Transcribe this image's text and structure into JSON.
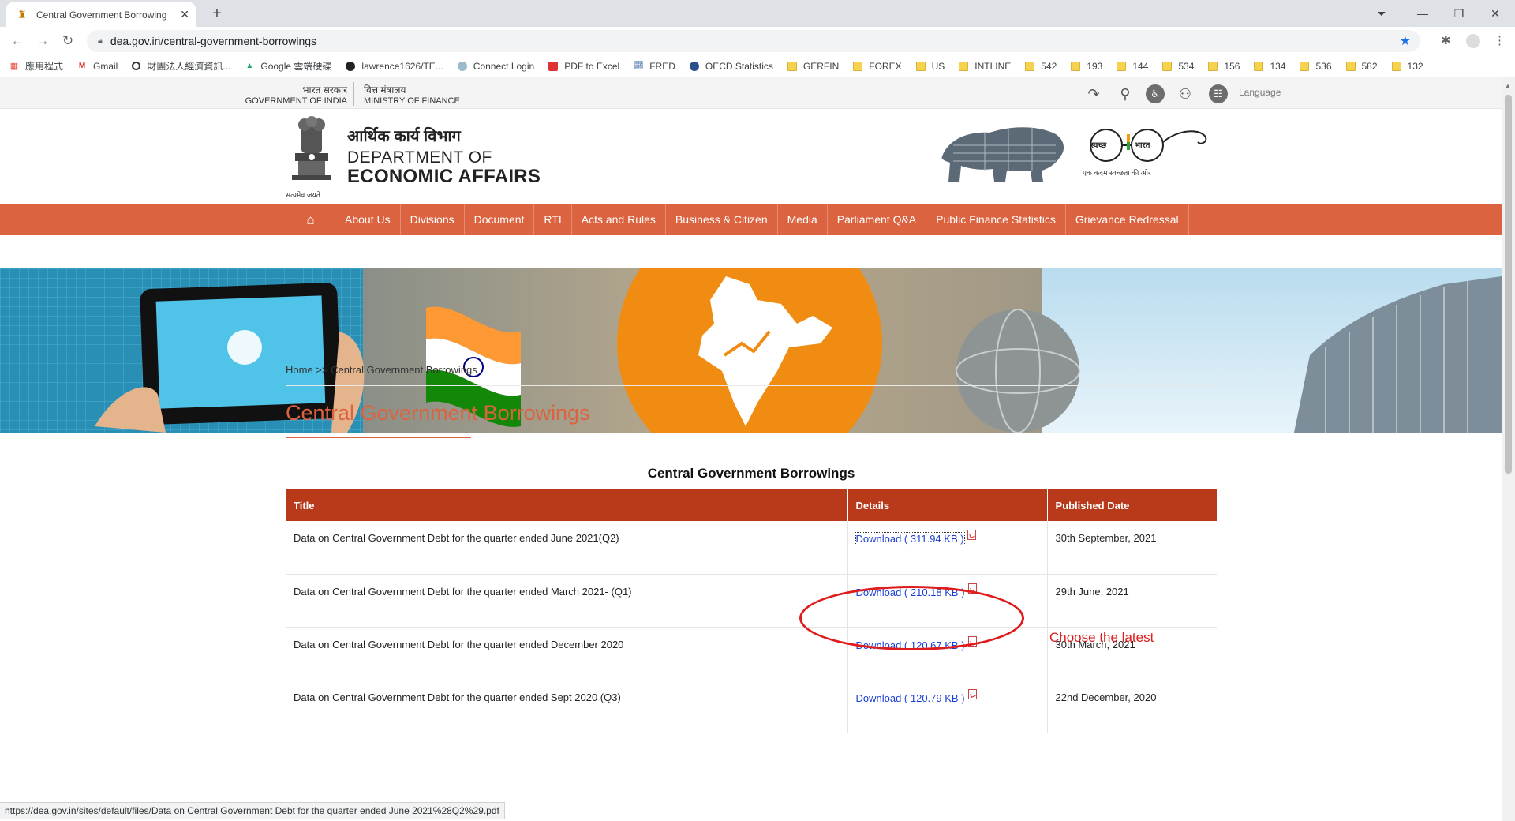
{
  "browser": {
    "tab_title": "Central Government Borrowing",
    "url": "dea.gov.in/central-government-borrowings",
    "bookmarks": [
      {
        "label": "應用程式",
        "icon": "apps-icon"
      },
      {
        "label": "Gmail",
        "icon": "gmail-icon"
      },
      {
        "label": "財團法人經濟資訊...",
        "icon": "globe-icon"
      },
      {
        "label": "Google 雲端硬碟",
        "icon": "drive-icon"
      },
      {
        "label": "lawrence1626/TE...",
        "icon": "github-icon"
      },
      {
        "label": "Connect Login",
        "icon": "connect-icon"
      },
      {
        "label": "PDF to Excel",
        "icon": "pdf-icon"
      },
      {
        "label": "FRED",
        "icon": "chart-icon"
      },
      {
        "label": "OECD Statistics",
        "icon": "oecd-icon"
      },
      {
        "label": "GERFIN",
        "icon": "folder-icon"
      },
      {
        "label": "FOREX",
        "icon": "folder-icon"
      },
      {
        "label": "US",
        "icon": "folder-icon"
      },
      {
        "label": "INTLINE",
        "icon": "folder-icon"
      },
      {
        "label": "542",
        "icon": "folder-icon"
      },
      {
        "label": "193",
        "icon": "folder-icon"
      },
      {
        "label": "144",
        "icon": "folder-icon"
      },
      {
        "label": "534",
        "icon": "folder-icon"
      },
      {
        "label": "156",
        "icon": "folder-icon"
      },
      {
        "label": "134",
        "icon": "folder-icon"
      },
      {
        "label": "536",
        "icon": "folder-icon"
      },
      {
        "label": "582",
        "icon": "folder-icon"
      },
      {
        "label": "132",
        "icon": "folder-icon"
      }
    ],
    "status_url": "https://dea.gov.in/sites/default/files/Data on Central Government Debt for the quarter ended June 2021%28Q2%29.pdf"
  },
  "topbar": {
    "gov_hindi": "भारत सरकार",
    "gov_english": "GOVERNMENT OF INDIA",
    "ministry_hindi": "वित्त मंत्रालय",
    "ministry_english": "MINISTRY OF FINANCE",
    "language_label": "Language"
  },
  "header": {
    "dept_hindi": "आर्थिक कार्य विभाग",
    "dept_line1": "DEPARTMENT OF",
    "dept_line2": "ECONOMIC AFFAIRS",
    "emblem_caption": "सत्यमेव जयते",
    "swachh_left": "स्वच्छ",
    "swachh_right": "भारत",
    "swachh_tagline": "एक कदम स्वच्छता की ओर"
  },
  "nav": {
    "items": [
      "About Us",
      "Divisions",
      "Document",
      "RTI",
      "Acts and Rules",
      "Business & Citizen",
      "Media",
      "Parliament Q&A",
      "Public Finance Statistics",
      "Grievance Redressal"
    ]
  },
  "breadcrumb": "Home >> Central Government Borrowings",
  "page_title": "Central Government Borrowings",
  "table": {
    "caption": "Central Government Borrowings",
    "headers": [
      "Title",
      "Details",
      "Published Date"
    ],
    "rows": [
      {
        "title": "Data on Central Government Debt for the quarter ended June 2021(Q2)",
        "link": "Download ( 311.94 KB )",
        "date": "30th September, 2021"
      },
      {
        "title": "Data on Central Government Debt for the quarter ended March 2021- (Q1)",
        "link": "Download ( 210.18 KB )",
        "date": "29th June, 2021"
      },
      {
        "title": "Data on Central Government Debt for the quarter ended December 2020",
        "link": "Download ( 120.67 KB )",
        "date": "30th March, 2021"
      },
      {
        "title": "Data on Central Government Debt for the quarter ended Sept 2020 (Q3)",
        "link": "Download ( 120.79 KB )",
        "date": "22nd December, 2020"
      }
    ]
  },
  "annotation": {
    "text": "Choose the latest",
    "color": "#e01b1b"
  },
  "colors": {
    "nav_orange": "#dc6340",
    "table_header": "#b83a1b",
    "link_blue": "#1a3fd6"
  }
}
